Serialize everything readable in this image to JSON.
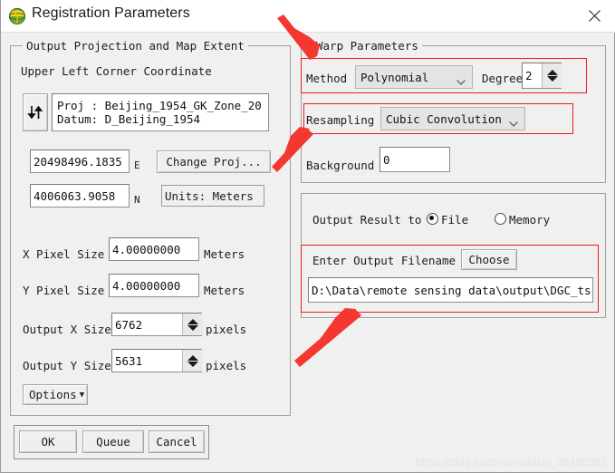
{
  "window": {
    "title": "Registration Parameters",
    "app_icon": "envi-globe-icon",
    "close_icon": "close-icon"
  },
  "output_projection": {
    "legend": "Output Projection and Map Extent",
    "corner_label": "Upper Left Corner Coordinate",
    "swap_icon": "swap-arrows-icon",
    "proj_line1": "Proj : Beijing_1954_GK_Zone_20",
    "proj_line2": "Datum: D_Beijing_1954",
    "easting_value": "20498496.1835",
    "easting_suffix": "E",
    "northing_value": "4006063.9058",
    "northing_suffix": "N",
    "change_proj_label": "Change Proj...",
    "units_label": "Units: Meters",
    "x_pixel_size_label": "X Pixel Size",
    "x_pixel_size_value": "4.00000000",
    "x_pixel_size_units": "Meters",
    "y_pixel_size_label": "Y Pixel Size",
    "y_pixel_size_value": "4.00000000",
    "y_pixel_size_units": "Meters",
    "output_x_size_label": "Output X Size",
    "output_x_size_value": "6762",
    "output_x_size_units": "pixels",
    "output_y_size_label": "Output Y Size",
    "output_y_size_value": "5631",
    "output_y_size_units": "pixels",
    "options_label": "Options",
    "options_caret": "▼"
  },
  "warp_parameters": {
    "legend": "Warp Parameters",
    "method_label": "Method",
    "method_value": "Polynomial",
    "degree_label": "Degree",
    "degree_value": "2",
    "resampling_label": "Resampling",
    "resampling_value": "Cubic Convolution",
    "background_label": "Background",
    "background_value": "0"
  },
  "output_result": {
    "result_to_label": "Output Result to",
    "file_option": "File",
    "memory_option": "Memory",
    "selected": "File",
    "filename_label": "Enter Output Filename",
    "choose_label": "Choose",
    "filename_value": "D:\\Data\\remote sensing data\\output\\DGC_ts"
  },
  "buttons": {
    "ok": "OK",
    "queue": "Queue",
    "cancel": "Cancel"
  },
  "annotation": {
    "color": "#ee1c1c"
  },
  "watermark": {
    "text": "https://blog.csdn.net/weixin_39190382"
  }
}
